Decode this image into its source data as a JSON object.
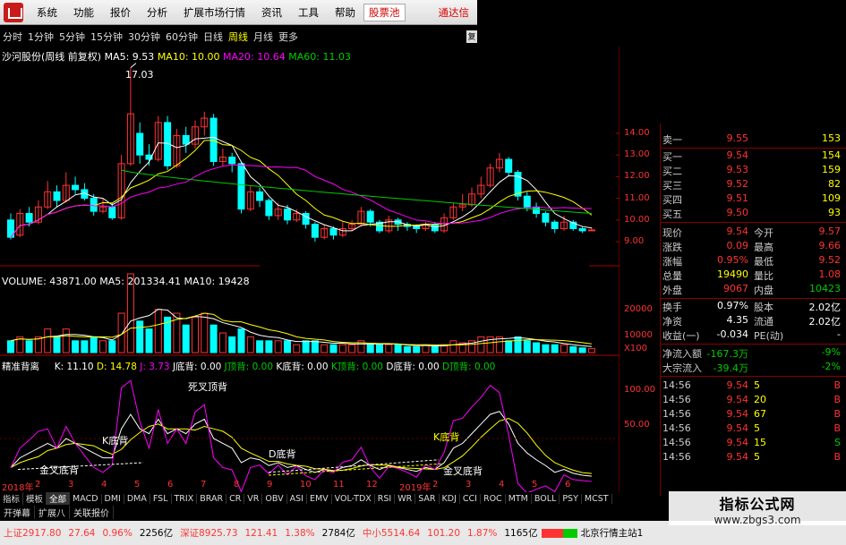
{
  "menu": {
    "items": [
      "系统",
      "功能",
      "报价",
      "分析",
      "扩展市场行情",
      "资讯",
      "工具",
      "帮助"
    ],
    "stock_pool": "股票池",
    "right_label": "通达信"
  },
  "toolbar": {
    "periods": [
      "分时",
      "1分钟",
      "5分钟",
      "15分钟",
      "30分钟",
      "60分钟",
      "日线",
      "周线",
      "月线",
      "更多"
    ],
    "active": "周线",
    "restore": "复"
  },
  "main_chart": {
    "title": "沙河股份(周线 前复权)",
    "ma5": "MA5: 9.53",
    "ma10": "MA10: 10.00",
    "ma20": "MA20: 10.64",
    "ma60": "MA60: 11.03",
    "high_label": "17.03",
    "y_ticks": [
      "14.00",
      "13.00",
      "12.00",
      "11.00",
      "10.00",
      "9.00"
    ]
  },
  "volume_chart": {
    "title": "VOLUME: 43871.00",
    "ma5": "MA5: 201334.41",
    "ma10": "MA10: 19428",
    "y_ticks": [
      "20000",
      "10000",
      "X100"
    ]
  },
  "kdj_chart": {
    "title": "精准背离",
    "k": "K: 11.10",
    "d": "D: 14.78",
    "j": "J: 3.73",
    "jdb": "J底背: 0.00",
    "jzb": "J顶背: 0.00",
    "kdb": "K底背: 0.00",
    "kzb": "K顶背: 0.00",
    "ddb": "D底背: 0.00",
    "dzb": "D顶背: 0.00",
    "y_ticks": [
      "100.00",
      "50.00"
    ],
    "annotations": {
      "dead_cross": "死叉顶背",
      "k_bottom": "K底背",
      "d_bottom": "D底背",
      "k_bottom2": "K底背",
      "golden1": "金叉底背",
      "golden2": "金叉底背"
    },
    "x_ticks": [
      "2018年",
      "2",
      "3",
      "4",
      "5",
      "6",
      "7",
      "8",
      "9",
      "10",
      "11",
      "12",
      "2019年",
      "2",
      "3",
      "4",
      "5",
      "6"
    ]
  },
  "quote": {
    "sell": [
      {
        "label": "卖一",
        "price": "9.55",
        "vol": "153"
      }
    ],
    "buy": [
      {
        "label": "买一",
        "price": "9.54",
        "vol": "154"
      },
      {
        "label": "买二",
        "price": "9.53",
        "vol": "159"
      },
      {
        "label": "买三",
        "price": "9.52",
        "vol": "82"
      },
      {
        "label": "买四",
        "price": "9.51",
        "vol": "109"
      },
      {
        "label": "买五",
        "price": "9.50",
        "vol": "93"
      }
    ],
    "stats": [
      {
        "l1": "现价",
        "v1": "9.54",
        "c1": "red",
        "l2": "今开",
        "v2": "9.57",
        "c2": "red"
      },
      {
        "l1": "涨跌",
        "v1": "0.09",
        "c1": "red",
        "l2": "最高",
        "v2": "9.66",
        "c2": "red"
      },
      {
        "l1": "涨幅",
        "v1": "0.95%",
        "c1": "red",
        "l2": "最低",
        "v2": "9.52",
        "c2": "red"
      },
      {
        "l1": "总量",
        "v1": "19490",
        "c1": "yellow",
        "l2": "量比",
        "v2": "1.08",
        "c2": "red"
      },
      {
        "l1": "外盘",
        "v1": "9067",
        "c1": "red",
        "l2": "内盘",
        "v2": "10423",
        "c2": "green"
      },
      {
        "l1": "换手",
        "v1": "0.97%",
        "c1": "white",
        "l2": "股本",
        "v2": "2.02亿",
        "c2": "white"
      },
      {
        "l1": "净资",
        "v1": "4.35",
        "c1": "white",
        "l2": "流通",
        "v2": "2.02亿",
        "c2": "white"
      },
      {
        "l1": "收益(一)",
        "v1": "-0.034",
        "c1": "white",
        "l2": "PE(动)",
        "v2": "-",
        "c2": "white"
      }
    ],
    "flows": [
      {
        "label": "净流入额",
        "value": "-167.3万",
        "pct": "-9%"
      },
      {
        "label": "大宗流入",
        "value": "-39.4万",
        "pct": "-2%"
      }
    ],
    "ticks": [
      {
        "time": "14:56",
        "price": "9.54",
        "vol": "5",
        "side": "B"
      },
      {
        "time": "14:56",
        "price": "9.54",
        "vol": "20",
        "side": "B"
      },
      {
        "time": "14:56",
        "price": "9.54",
        "vol": "67",
        "side": "B"
      },
      {
        "time": "14:56",
        "price": "9.54",
        "vol": "5",
        "side": "B"
      },
      {
        "time": "14:56",
        "price": "9.54",
        "vol": "15",
        "side": "S"
      },
      {
        "time": "14:56",
        "price": "9.54",
        "vol": "5",
        "side": "B"
      }
    ]
  },
  "indicator_tabs": [
    "指标",
    "模板",
    "全部",
    "MACD",
    "DMI",
    "DMA",
    "FSL",
    "TRIX",
    "BRAR",
    "CR",
    "VR",
    "OBV",
    "ASI",
    "EMV",
    "VOL-TDX",
    "RSI",
    "WR",
    "SAR",
    "KDJ",
    "CCI",
    "ROC",
    "MTM",
    "BOLL",
    "PSY",
    "MCST"
  ],
  "bottom_tabs": [
    "开弹幕",
    "扩展八",
    "关联报价"
  ],
  "status": {
    "sh": "上证2917.80",
    "sh_chg": "27.64",
    "sh_pct": "0.96%",
    "sh_amt": "2256亿",
    "sz": "深证8925.73",
    "sz_chg": "121.41",
    "sz_pct": "1.38%",
    "sz_amt": "2784亿",
    "zx": "中小5514.64",
    "zx_chg": "101.20",
    "zx_pct": "1.87%",
    "zx_amt": "1165亿",
    "site": "北京行情主站1"
  },
  "watermark": {
    "title": "指标公式网",
    "url": "www.zbgs3.com"
  },
  "colors": {
    "up": "#ff3333",
    "down": "#00ffff",
    "ma5": "#ffffff",
    "ma10": "#ffff00",
    "ma20": "#ff00ff",
    "ma60": "#00cc00"
  }
}
